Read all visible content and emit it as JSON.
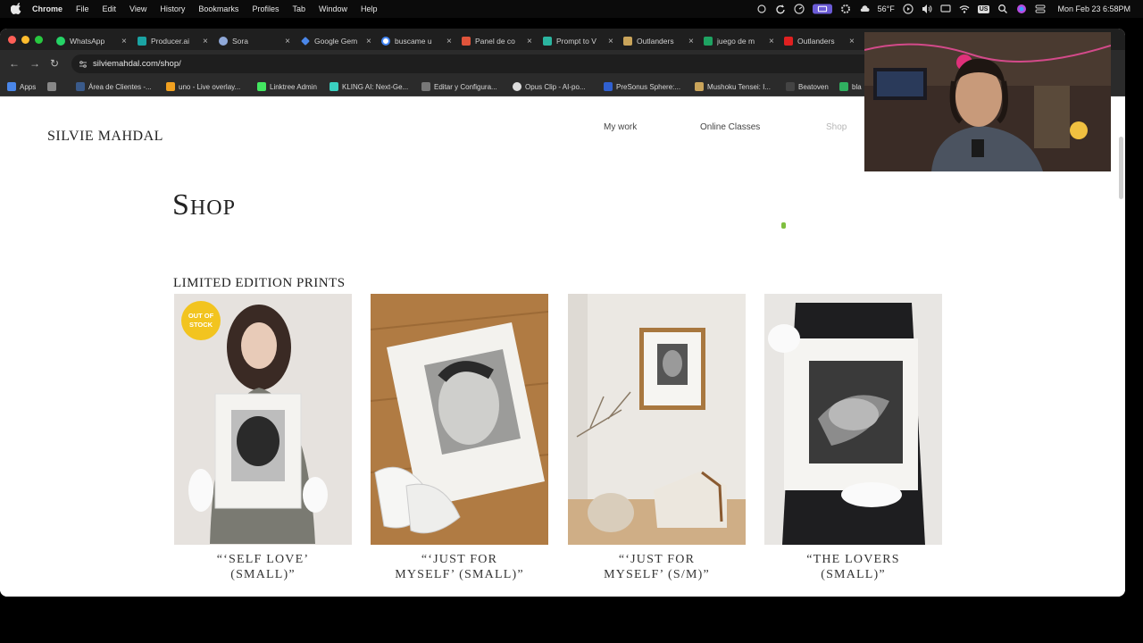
{
  "menubar": {
    "app": "Chrome",
    "items": [
      "File",
      "Edit",
      "View",
      "History",
      "Bookmarks",
      "Profiles",
      "Tab",
      "Window",
      "Help"
    ],
    "weather": "56°F",
    "input_source": "US",
    "clock": "Mon Feb 23  6:58PM"
  },
  "browser": {
    "tabs": [
      {
        "title": "WhatsApp",
        "color": "#25d366"
      },
      {
        "title": "Producer.ai",
        "color": "#1aa3a3"
      },
      {
        "title": "Sora",
        "color": "#8fa8d8"
      },
      {
        "title": "Google Gem",
        "color": "#4a86e8"
      },
      {
        "title": "buscame u",
        "color": "#ffffff"
      },
      {
        "title": "Panel de co",
        "color": "#e0543b"
      },
      {
        "title": "Prompt to V",
        "color": "#2bb5a0"
      },
      {
        "title": "Outlanders",
        "color": "#c9a45a"
      },
      {
        "title": "juego de m",
        "color": "#1ea362"
      },
      {
        "title": "Outlanders",
        "color": "#e02020"
      }
    ],
    "url": "silviemahdal.com/shop/",
    "bookmarks": [
      {
        "title": "Apps",
        "color": "#4a86e8"
      },
      {
        "title": "",
        "color": "#888888"
      },
      {
        "title": "Área de Clientes -...",
        "color": "#3a5a8a"
      },
      {
        "title": "uno - Live overlay...",
        "color": "#f0a020"
      },
      {
        "title": "Linktree Admin",
        "color": "#43e660"
      },
      {
        "title": "KLING AI: Next-Ge...",
        "color": "#3ad0c0"
      },
      {
        "title": "Editar y Configura...",
        "color": "#777777"
      },
      {
        "title": "Opus Clip - AI-po...",
        "color": "#dddddd"
      },
      {
        "title": "PreSonus Sphere:...",
        "color": "#3060d0"
      },
      {
        "title": "Mushoku Tensei: I...",
        "color": "#c9a45a"
      },
      {
        "title": "Beatoven",
        "color": "#444444"
      },
      {
        "title": "bla",
        "color": "#30b060"
      }
    ]
  },
  "site": {
    "brand": "SILVIE MAHDAL",
    "nav": [
      "My work",
      "Online Classes",
      "Shop"
    ],
    "page_title": "Shop",
    "section_title": "LIMITED EDITION PRINTS",
    "products": [
      {
        "caption": "“‘SELF LOVE’ (SMALL)”",
        "badge": "OUT OF STOCK"
      },
      {
        "caption": "“‘JUST FOR MYSELF’ (SMALL)”",
        "badge": ""
      },
      {
        "caption": "“‘JUST FOR MYSELF’ (S/M)”",
        "badge": ""
      },
      {
        "caption": "“THE LOVERS (SMALL)”",
        "badge": ""
      }
    ]
  }
}
